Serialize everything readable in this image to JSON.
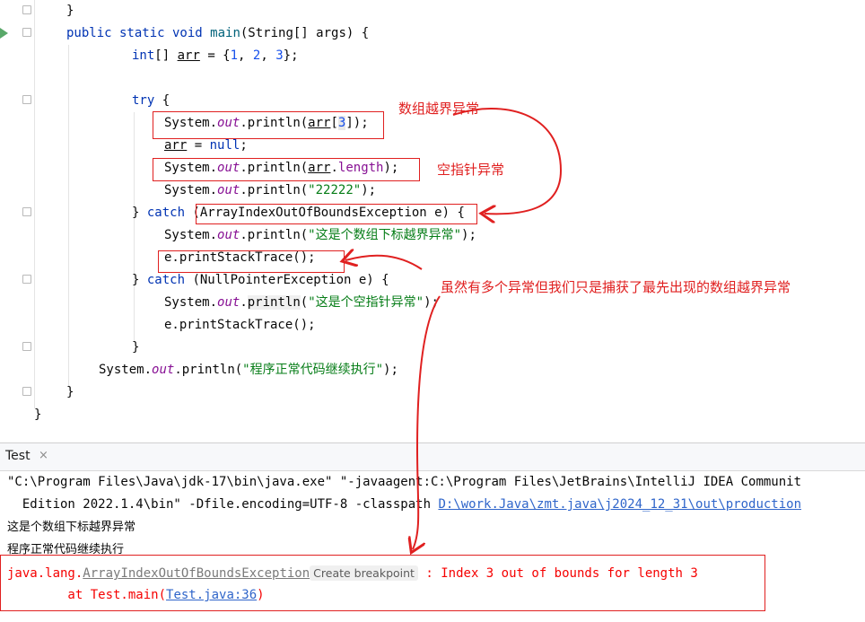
{
  "editor": {
    "lines": {
      "l0": "}",
      "l1_kw": "public static void ",
      "l1_fn": "main",
      "l1_rest": "(String[] args) {",
      "l2_kw": "int",
      "l2_a": "[] ",
      "l2_arr": "arr",
      "l2_b": " = {",
      "l2_n1": "1",
      "l2_c1": ", ",
      "l2_n2": "2",
      "l2_c2": ", ",
      "l2_n3": "3",
      "l2_end": "};",
      "l4_kw": "try",
      "l4_rest": " {",
      "sys": "System.",
      "out": "out",
      "println": ".println(",
      "l5_arr": "arr",
      "l5_a": "[",
      "l5_n": "3",
      "l5_end": "]);",
      "l6_arr": "arr",
      "l6_a": " = ",
      "l6_null": "null",
      "l6_end": ";",
      "l7_arr": "arr",
      "l7_dot": ".",
      "l7_len": "length",
      "l7_end": ");",
      "l8_str": "\"22222\"",
      "l8_end": ");",
      "l9_a": "} ",
      "l9_kw": "catch",
      "l9_rest": " (ArrayIndexOutOfBoundsException e) {",
      "l10_str": "\"这是个数组下标越界异常\"",
      "l10_end": ");",
      "l11": "e.printStackTrace();",
      "l12_a": "} ",
      "l12_kw": "catch",
      "l12_rest": " (NullPointerException e) {",
      "l13_sys": "System.",
      "l13_mid": ".",
      "l13_pl": "println",
      "l13_b": "(",
      "l13_str": "\"这是个空指针异常\"",
      "l13_end": ");",
      "l14": "e.printStackTrace();",
      "l15": "}",
      "l16_str": "\"程序正常代码继续执行\"",
      "l16_end": ");",
      "l17": "}",
      "l18": "}"
    },
    "annotations": {
      "array_oob": "数组越界异常",
      "null_ptr": "空指针异常",
      "explanation": "虽然有多个异常但我们只是捕获了最先出现的数组越界异常"
    }
  },
  "run_panel": {
    "tab_label": "Test",
    "close_glyph": "×",
    "cmd_line1": "\"C:\\Program Files\\Java\\jdk-17\\bin\\java.exe\" \"-javaagent:C:\\Program Files\\JetBrains\\IntelliJ IDEA Communit",
    "cmd_line2_text": "  Edition 2022.1.4\\bin\" -Dfile.encoding=UTF-8 -classpath ",
    "cmd_line2_link": "D:\\work.Java\\zmt.java\\j2024_12_31\\out\\production",
    "out1": "这是个数组下标越界异常",
    "out2": "程序正常代码继续执行",
    "err_prefix": "java.lang.",
    "err_class": "ArrayIndexOutOfBoundsException",
    "create_bp": "Create breakpoint",
    "err_msg": " : Index 3 out of bounds for length 3",
    "at_prefix": "        at Test.main(",
    "at_link": "Test.java:36",
    "at_suffix": ")"
  },
  "colors": {
    "annotation": "#e02020",
    "keyword": "#0033b3",
    "string": "#067d17",
    "error": "#f50000",
    "link": "#2f65ca",
    "run_gutter": "#59a869"
  }
}
